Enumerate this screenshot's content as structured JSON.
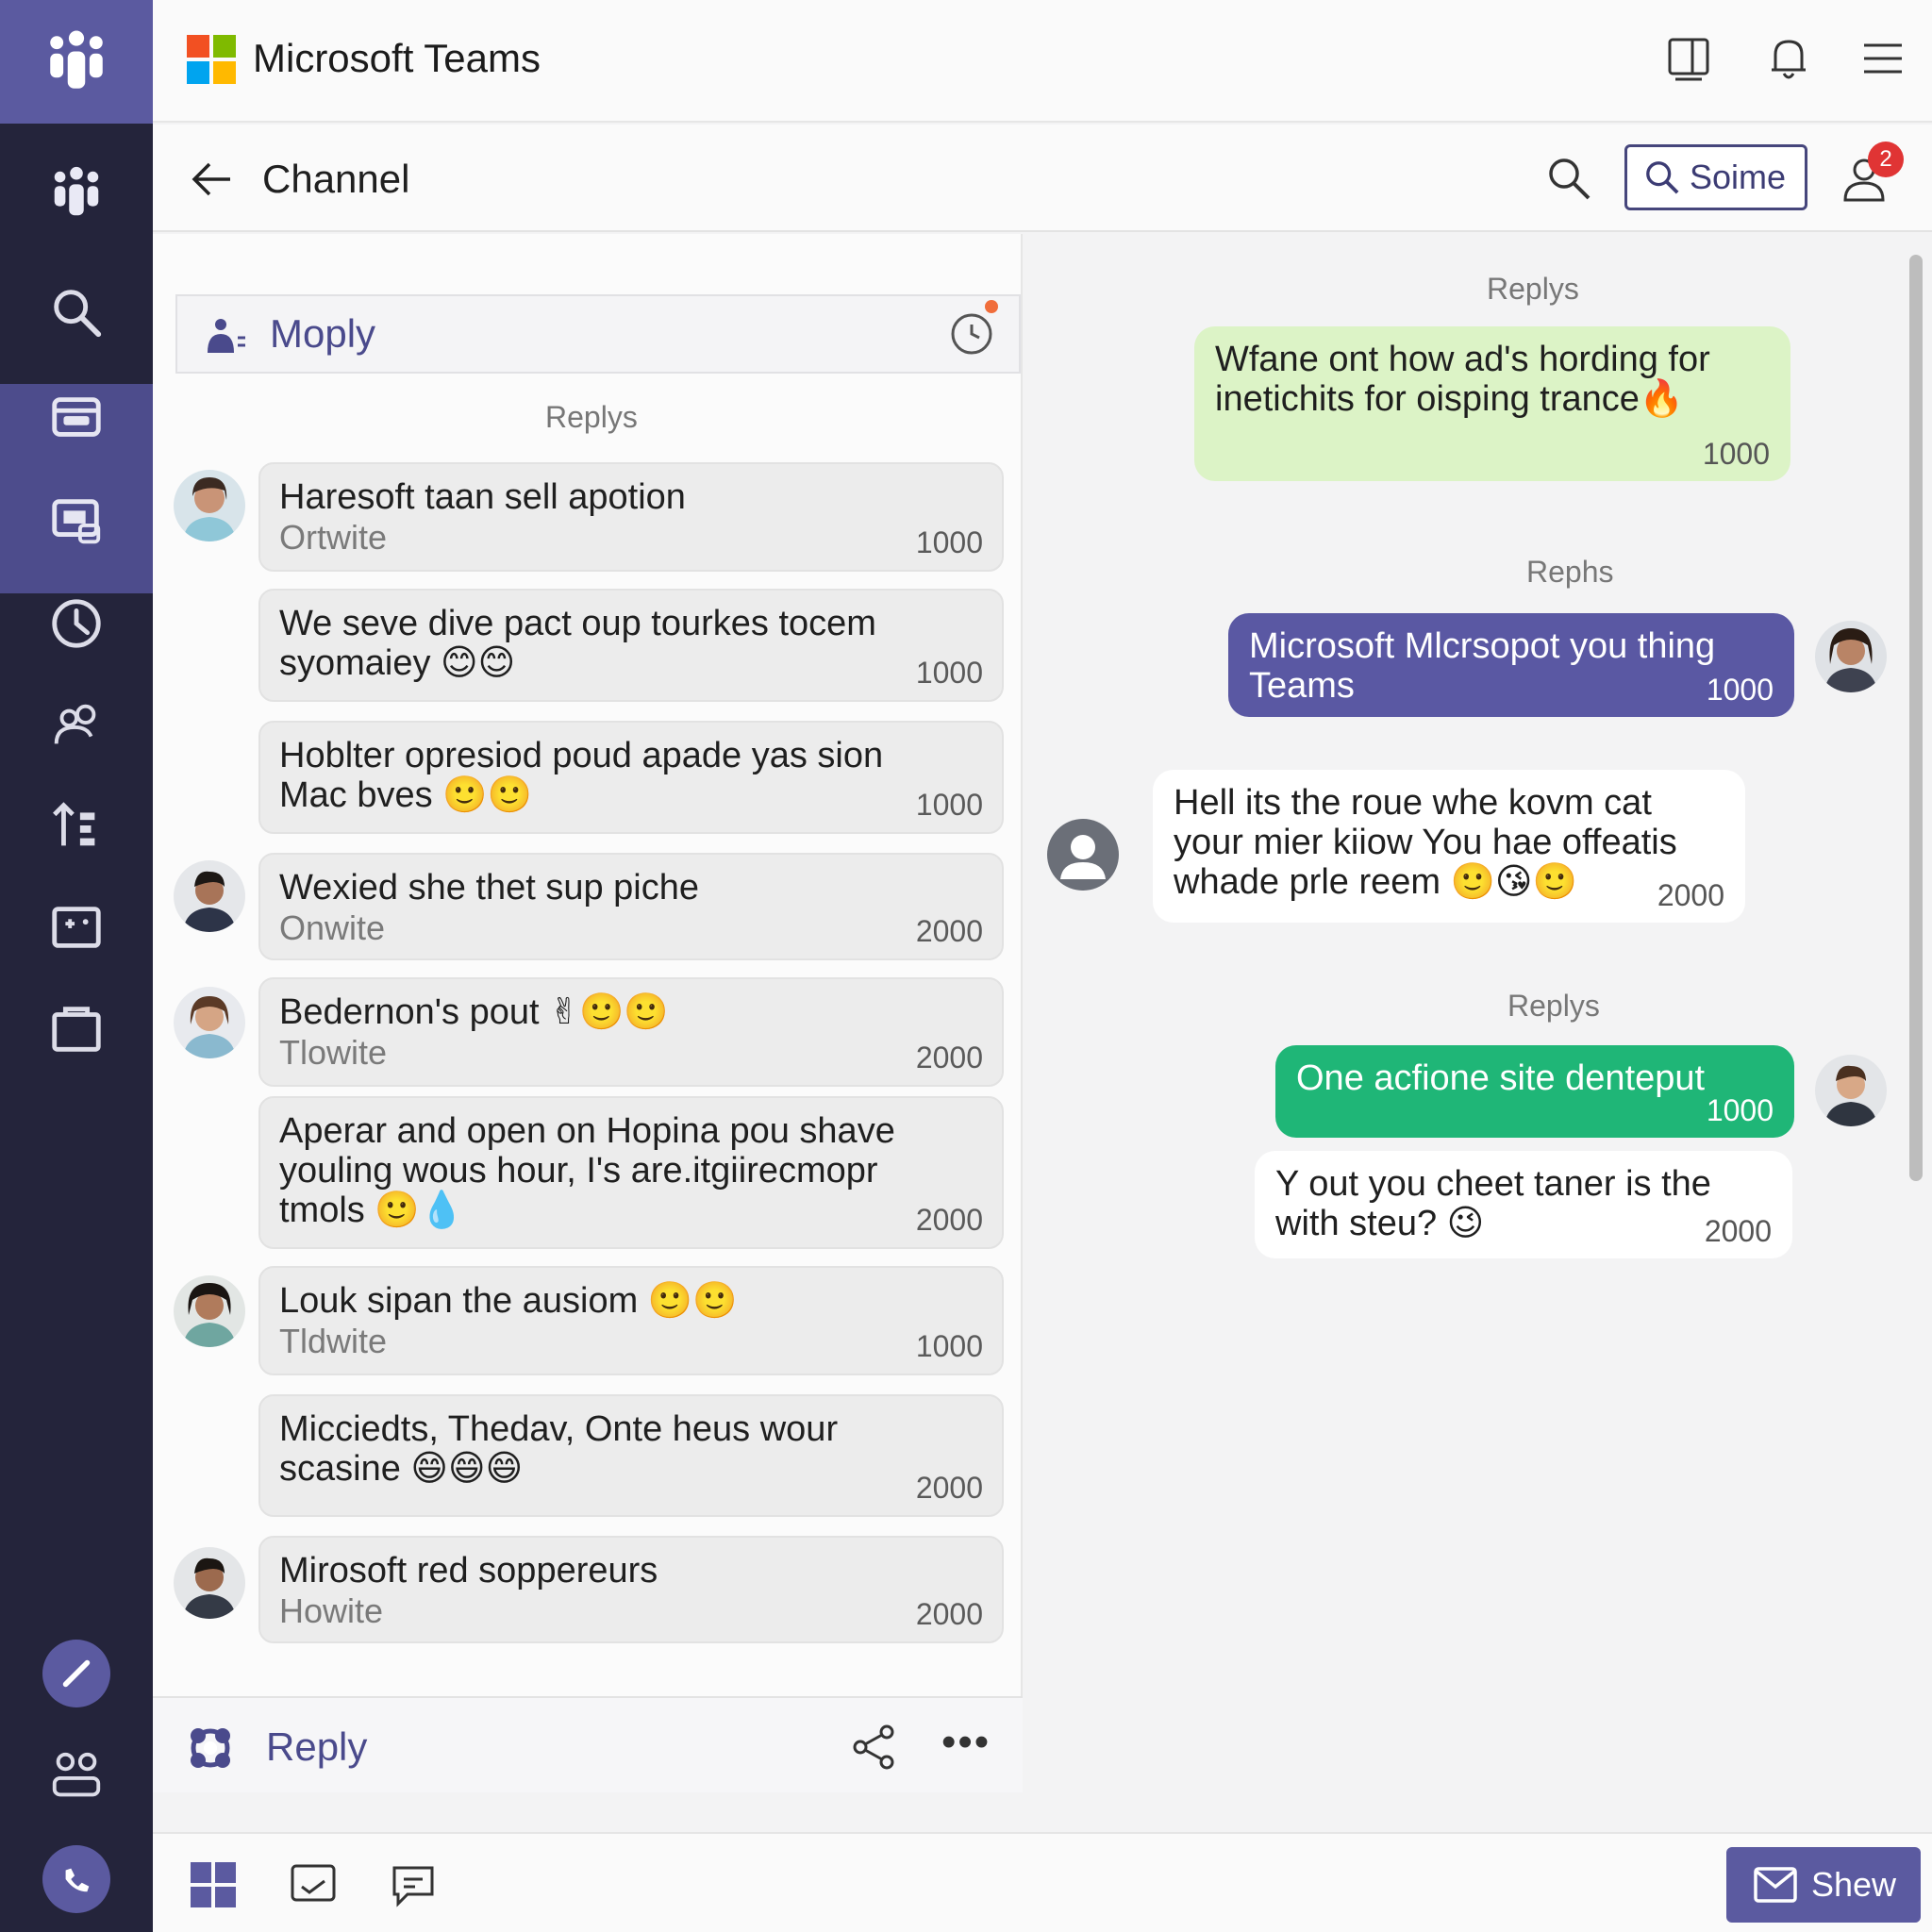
{
  "header": {
    "app_title": "Microsoft Teams"
  },
  "channel": {
    "title": "Channel",
    "search_button_label": "Soime",
    "notification_count": "2"
  },
  "thread_panel": {
    "title": "Moply",
    "section_label": "Replys"
  },
  "left_messages": [
    {
      "text": "Haresoft taan sell apotion",
      "sub": "Ortwite",
      "count": "1000"
    },
    {
      "text": "We seve dive pact oup tourkes tocem syomaiey 😊😊",
      "sub": "",
      "count": "1000"
    },
    {
      "text": "Hoblter opresiod poud apade yas sion Mac bves 🙂🙂",
      "sub": "",
      "count": "1000"
    },
    {
      "text": "Wexied she thet sup piche",
      "sub": "Onwite",
      "count": "2000"
    },
    {
      "text": "Bedernon's pout ✌🙂🙂",
      "sub": "Tlowite",
      "count": "2000"
    },
    {
      "text": "Aperar and open on Hopina pou shave youling wous hour, I's are.itgiirecmopr tmols 🙂💧",
      "sub": "",
      "count": "2000"
    },
    {
      "text": "Louk sipan the ausiom 🙂🙂",
      "sub": "Tldwite",
      "count": "1000"
    },
    {
      "text": "Micciedts, Thedav, Onte heus wour scasine 😄😄😄",
      "sub": "",
      "count": "2000"
    },
    {
      "text": "Mirosoft red soppereurs",
      "sub": "Howite",
      "count": "2000"
    }
  ],
  "reply_bar": {
    "label": "Reply"
  },
  "right_labels": [
    "Replys",
    "Rephs",
    "Replys"
  ],
  "right_messages": [
    {
      "text": "Wfane ont how ad's hording for inetichits for oisping trance🔥",
      "count": "1000"
    },
    {
      "text": "Microsoft Mlcrsopot you thing Teams",
      "count": "1000"
    },
    {
      "text": "Hell its the roue whe kovm cat your mier kiiow You hae offeatis whade prle reem 🙂😘🙂",
      "count": "2000"
    },
    {
      "text": "One acfione site denteput",
      "count": "1000"
    },
    {
      "text": "Y out you cheet taner is the with steu? 😉",
      "count": "2000"
    }
  ],
  "bottom": {
    "show_button_label": "Shew"
  },
  "colors": {
    "rail": "#24243b",
    "brand_purple": "#5b5aa0",
    "bubble_light_green": "#dcf3c6",
    "bubble_purple": "#5a58a3",
    "bubble_green": "#1fb677",
    "badge_red": "#e03434"
  },
  "icons": {
    "rail": [
      "teams-logo-icon",
      "teams-icon",
      "search-icon",
      "calendar-icon",
      "meeting-icon",
      "clock-icon",
      "people-icon",
      "sort-icon",
      "board-icon",
      "folder-icon",
      "edit-icon",
      "groups-icon",
      "call-icon"
    ],
    "topbar": [
      "tablet-icon",
      "bell-icon",
      "menu-icon"
    ],
    "bottom": [
      "apps-icon",
      "chat-icon",
      "message-icon",
      "mail-icon"
    ]
  }
}
